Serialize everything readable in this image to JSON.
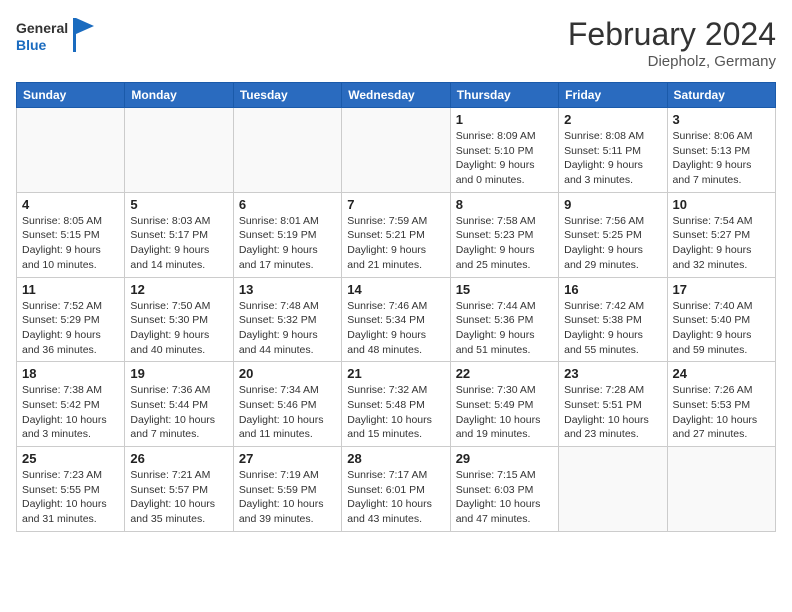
{
  "header": {
    "logo_general": "General",
    "logo_blue": "Blue",
    "month": "February 2024",
    "location": "Diepholz, Germany"
  },
  "days_of_week": [
    "Sunday",
    "Monday",
    "Tuesday",
    "Wednesday",
    "Thursday",
    "Friday",
    "Saturday"
  ],
  "weeks": [
    [
      {
        "day": "",
        "info": ""
      },
      {
        "day": "",
        "info": ""
      },
      {
        "day": "",
        "info": ""
      },
      {
        "day": "",
        "info": ""
      },
      {
        "day": "1",
        "info": "Sunrise: 8:09 AM\nSunset: 5:10 PM\nDaylight: 9 hours\nand 0 minutes."
      },
      {
        "day": "2",
        "info": "Sunrise: 8:08 AM\nSunset: 5:11 PM\nDaylight: 9 hours\nand 3 minutes."
      },
      {
        "day": "3",
        "info": "Sunrise: 8:06 AM\nSunset: 5:13 PM\nDaylight: 9 hours\nand 7 minutes."
      }
    ],
    [
      {
        "day": "4",
        "info": "Sunrise: 8:05 AM\nSunset: 5:15 PM\nDaylight: 9 hours\nand 10 minutes."
      },
      {
        "day": "5",
        "info": "Sunrise: 8:03 AM\nSunset: 5:17 PM\nDaylight: 9 hours\nand 14 minutes."
      },
      {
        "day": "6",
        "info": "Sunrise: 8:01 AM\nSunset: 5:19 PM\nDaylight: 9 hours\nand 17 minutes."
      },
      {
        "day": "7",
        "info": "Sunrise: 7:59 AM\nSunset: 5:21 PM\nDaylight: 9 hours\nand 21 minutes."
      },
      {
        "day": "8",
        "info": "Sunrise: 7:58 AM\nSunset: 5:23 PM\nDaylight: 9 hours\nand 25 minutes."
      },
      {
        "day": "9",
        "info": "Sunrise: 7:56 AM\nSunset: 5:25 PM\nDaylight: 9 hours\nand 29 minutes."
      },
      {
        "day": "10",
        "info": "Sunrise: 7:54 AM\nSunset: 5:27 PM\nDaylight: 9 hours\nand 32 minutes."
      }
    ],
    [
      {
        "day": "11",
        "info": "Sunrise: 7:52 AM\nSunset: 5:29 PM\nDaylight: 9 hours\nand 36 minutes."
      },
      {
        "day": "12",
        "info": "Sunrise: 7:50 AM\nSunset: 5:30 PM\nDaylight: 9 hours\nand 40 minutes."
      },
      {
        "day": "13",
        "info": "Sunrise: 7:48 AM\nSunset: 5:32 PM\nDaylight: 9 hours\nand 44 minutes."
      },
      {
        "day": "14",
        "info": "Sunrise: 7:46 AM\nSunset: 5:34 PM\nDaylight: 9 hours\nand 48 minutes."
      },
      {
        "day": "15",
        "info": "Sunrise: 7:44 AM\nSunset: 5:36 PM\nDaylight: 9 hours\nand 51 minutes."
      },
      {
        "day": "16",
        "info": "Sunrise: 7:42 AM\nSunset: 5:38 PM\nDaylight: 9 hours\nand 55 minutes."
      },
      {
        "day": "17",
        "info": "Sunrise: 7:40 AM\nSunset: 5:40 PM\nDaylight: 9 hours\nand 59 minutes."
      }
    ],
    [
      {
        "day": "18",
        "info": "Sunrise: 7:38 AM\nSunset: 5:42 PM\nDaylight: 10 hours\nand 3 minutes."
      },
      {
        "day": "19",
        "info": "Sunrise: 7:36 AM\nSunset: 5:44 PM\nDaylight: 10 hours\nand 7 minutes."
      },
      {
        "day": "20",
        "info": "Sunrise: 7:34 AM\nSunset: 5:46 PM\nDaylight: 10 hours\nand 11 minutes."
      },
      {
        "day": "21",
        "info": "Sunrise: 7:32 AM\nSunset: 5:48 PM\nDaylight: 10 hours\nand 15 minutes."
      },
      {
        "day": "22",
        "info": "Sunrise: 7:30 AM\nSunset: 5:49 PM\nDaylight: 10 hours\nand 19 minutes."
      },
      {
        "day": "23",
        "info": "Sunrise: 7:28 AM\nSunset: 5:51 PM\nDaylight: 10 hours\nand 23 minutes."
      },
      {
        "day": "24",
        "info": "Sunrise: 7:26 AM\nSunset: 5:53 PM\nDaylight: 10 hours\nand 27 minutes."
      }
    ],
    [
      {
        "day": "25",
        "info": "Sunrise: 7:23 AM\nSunset: 5:55 PM\nDaylight: 10 hours\nand 31 minutes."
      },
      {
        "day": "26",
        "info": "Sunrise: 7:21 AM\nSunset: 5:57 PM\nDaylight: 10 hours\nand 35 minutes."
      },
      {
        "day": "27",
        "info": "Sunrise: 7:19 AM\nSunset: 5:59 PM\nDaylight: 10 hours\nand 39 minutes."
      },
      {
        "day": "28",
        "info": "Sunrise: 7:17 AM\nSunset: 6:01 PM\nDaylight: 10 hours\nand 43 minutes."
      },
      {
        "day": "29",
        "info": "Sunrise: 7:15 AM\nSunset: 6:03 PM\nDaylight: 10 hours\nand 47 minutes."
      },
      {
        "day": "",
        "info": ""
      },
      {
        "day": "",
        "info": ""
      }
    ]
  ]
}
